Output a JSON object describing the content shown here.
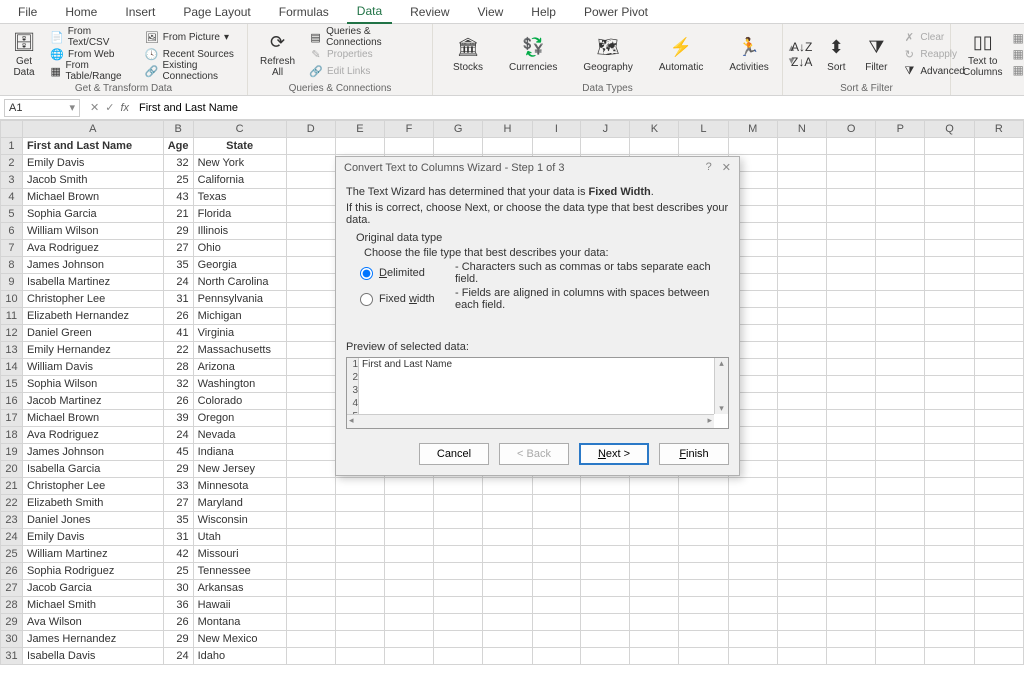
{
  "tabs": [
    "File",
    "Home",
    "Insert",
    "Page Layout",
    "Formulas",
    "Data",
    "Review",
    "View",
    "Help",
    "Power Pivot"
  ],
  "active_tab": "Data",
  "ribbon": {
    "group1": {
      "title": "Get & Transform Data",
      "getdata": "Get\nData",
      "items": [
        "From Text/CSV",
        "From Web",
        "From Table/Range",
        "From Picture",
        "Recent Sources",
        "Existing Connections"
      ]
    },
    "group2": {
      "title": "Queries & Connections",
      "refresh": "Refresh\nAll",
      "items": [
        "Queries & Connections",
        "Properties",
        "Edit Links"
      ]
    },
    "group3": {
      "title": "Data Types",
      "items": [
        "Stocks",
        "Currencies",
        "Geography",
        "Automatic",
        "Activities"
      ]
    },
    "group4": {
      "title": "Sort & Filter",
      "sort": "Sort",
      "filter": "Filter",
      "items": [
        "Clear",
        "Reapply",
        "Advanced"
      ]
    },
    "group5": {
      "ttc": "Text to\nColumns"
    }
  },
  "namebox": "A1",
  "formula": "First and Last Name",
  "columns": [
    "A",
    "B",
    "C",
    "D",
    "E",
    "F",
    "G",
    "H",
    "I",
    "J",
    "K",
    "L",
    "M",
    "N",
    "O",
    "P",
    "Q",
    "R"
  ],
  "header_row": [
    "First and Last Name",
    "Age",
    "State"
  ],
  "rows": [
    [
      "Emily Davis",
      "32",
      "New York"
    ],
    [
      "Jacob Smith",
      "25",
      "California"
    ],
    [
      "Michael Brown",
      "43",
      "Texas"
    ],
    [
      "Sophia Garcia",
      "21",
      "Florida"
    ],
    [
      "William Wilson",
      "29",
      "Illinois"
    ],
    [
      "Ava Rodriguez",
      "27",
      "Ohio"
    ],
    [
      "James Johnson",
      "35",
      "Georgia"
    ],
    [
      "Isabella Martinez",
      "24",
      "North Carolina"
    ],
    [
      "Christopher Lee",
      "31",
      "Pennsylvania"
    ],
    [
      "Elizabeth Hernandez",
      "26",
      "Michigan"
    ],
    [
      "Daniel Green",
      "41",
      "Virginia"
    ],
    [
      "Emily Hernandez",
      "22",
      "Massachusetts"
    ],
    [
      "William Davis",
      "28",
      "Arizona"
    ],
    [
      "Sophia Wilson",
      "32",
      "Washington"
    ],
    [
      "Jacob Martinez",
      "26",
      "Colorado"
    ],
    [
      "Michael Brown",
      "39",
      "Oregon"
    ],
    [
      "Ava Rodriguez",
      "24",
      "Nevada"
    ],
    [
      "James Johnson",
      "45",
      "Indiana"
    ],
    [
      "Isabella Garcia",
      "29",
      "New Jersey"
    ],
    [
      "Christopher Lee",
      "33",
      "Minnesota"
    ],
    [
      "Elizabeth Smith",
      "27",
      "Maryland"
    ],
    [
      "Daniel Jones",
      "35",
      "Wisconsin"
    ],
    [
      "Emily Davis",
      "31",
      "Utah"
    ],
    [
      "William Martinez",
      "42",
      "Missouri"
    ],
    [
      "Sophia Rodriguez",
      "25",
      "Tennessee"
    ],
    [
      "Jacob Garcia",
      "30",
      "Arkansas"
    ],
    [
      "Michael Smith",
      "36",
      "Hawaii"
    ],
    [
      "Ava Wilson",
      "26",
      "Montana"
    ],
    [
      "James Hernandez",
      "29",
      "New Mexico"
    ],
    [
      "Isabella Davis",
      "24",
      "Idaho"
    ]
  ],
  "dialog": {
    "title": "Convert Text to Columns Wizard - Step 1 of 3",
    "line1_a": "The Text Wizard has determined that your data is ",
    "line1_b": "Fixed Width",
    "line1_c": ".",
    "line2": "If this is correct, choose Next, or choose the data type that best describes your data.",
    "original": "Original data type",
    "choose": "Choose the file type that best describes your data:",
    "opt_delim": "Delimited",
    "opt_delim_desc": "- Characters such as commas or tabs separate each field.",
    "opt_fixed": "Fixed width",
    "opt_fixed_desc": "- Fields are aligned in columns with spaces between each field.",
    "preview_lbl": "Preview of selected data:",
    "preview_rows": [
      "First and Last Name",
      "",
      "",
      "",
      ""
    ],
    "btn_cancel": "Cancel",
    "btn_back": "< Back",
    "btn_next": "Next >",
    "btn_finish": "Finish"
  }
}
